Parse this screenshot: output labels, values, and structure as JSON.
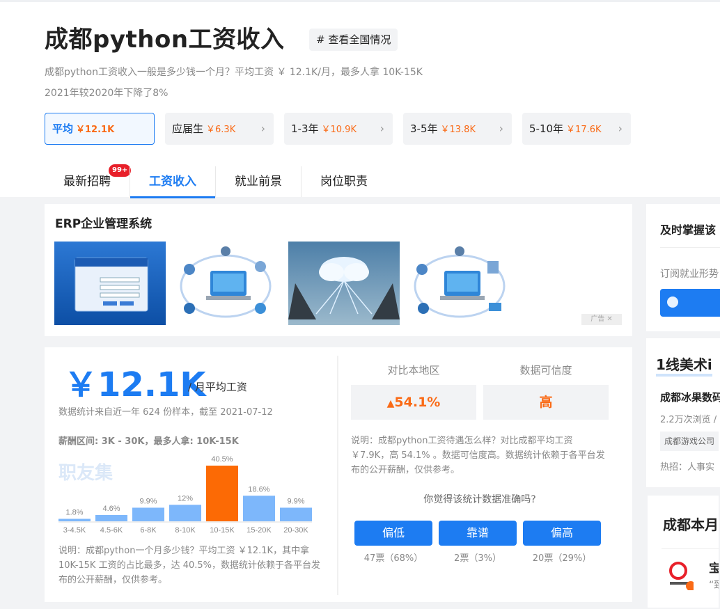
{
  "header": {
    "title": "成都python工资收入",
    "tag_button": "# 查看全国情况",
    "desc_line1": "成都python工资收入一般是多少钱一个月？平均工资 ￥ 12.1K/月，最多人拿 10K-15K",
    "desc_line2": "2021年较2020年下降了8%"
  },
  "pills": [
    {
      "label": "平均",
      "value": "￥12.1K"
    },
    {
      "label": "应届生",
      "value": "￥6.3K"
    },
    {
      "label": "1-3年",
      "value": "￥10.9K"
    },
    {
      "label": "3-5年",
      "value": "￥13.8K"
    },
    {
      "label": "5-10年",
      "value": "￥17.6K"
    }
  ],
  "tabs": {
    "t1": "最新招聘",
    "t1_badge": "99+",
    "t2": "工资收入",
    "t3": "就业前景",
    "t4": "岗位职责"
  },
  "ad": {
    "title": "ERP企业管理系统",
    "label": "广告 ✕"
  },
  "salary": {
    "value": "￥12.1K",
    "unit": "/ 月平均工资",
    "stat_note": "数据统计来自近一年 624 份样本，截至 2021-07-12",
    "range": "薪酬区间: 3K - 30K，最多人拿:  10K-15K",
    "watermark": "职友集",
    "note": "说明：成都python一个月多少钱？平均工资 ￥12.1K，其中拿10K-15K 工资的占比最多，达 40.5%，数据统计依赖于各平台发布的公开薪酬，仅供参考。"
  },
  "chart_data": {
    "type": "bar",
    "categories": [
      "3-4.5K",
      "4.5-6K",
      "6-8K",
      "8-10K",
      "10-15K",
      "15-20K",
      "20-30K"
    ],
    "values": [
      1.8,
      4.6,
      9.9,
      12,
      40.5,
      18.6,
      9.9
    ],
    "value_labels": [
      "1.8%",
      "4.6%",
      "9.9%",
      "12%",
      "40.5%",
      "18.6%",
      "9.9%"
    ],
    "highlight_index": 4,
    "colors": {
      "bar": "#7db7fb",
      "highlight": "#fc6a05"
    }
  },
  "compare": {
    "head1": "对比本地区",
    "head2": "数据可信度",
    "value1": "54.1%",
    "value2": "高",
    "note": "说明：成都python工资待遇怎么样？对比成都平均工资￥7.9K，高 54.1% 。数据可信度高。数据统计依赖于各平台发布的公开薪酬，仅供参考。",
    "ask": "你觉得该统计数据准确吗?",
    "votes": [
      {
        "label": "偏低",
        "count": "47票（68%）"
      },
      {
        "label": "靠谱",
        "count": "2票（3%）"
      },
      {
        "label": "偏高",
        "count": "20票（29%）"
      }
    ]
  },
  "sidebar": {
    "card1_title": "及时掌握该",
    "card1_text": "订阅就业形势",
    "card2_title": "1线美术i",
    "card2_company": "成都冰果数码",
    "card2_meta": "2.2万次浏览 /",
    "card2_tag": "成都游戏公司",
    "card2_hot": "热招：人事实",
    "card3_title": "成都本月",
    "card3_item": "宝",
    "card3_quote": "“致"
  },
  "colors": {
    "accent": "#1d7cf2",
    "orange": "#fa6a16"
  }
}
